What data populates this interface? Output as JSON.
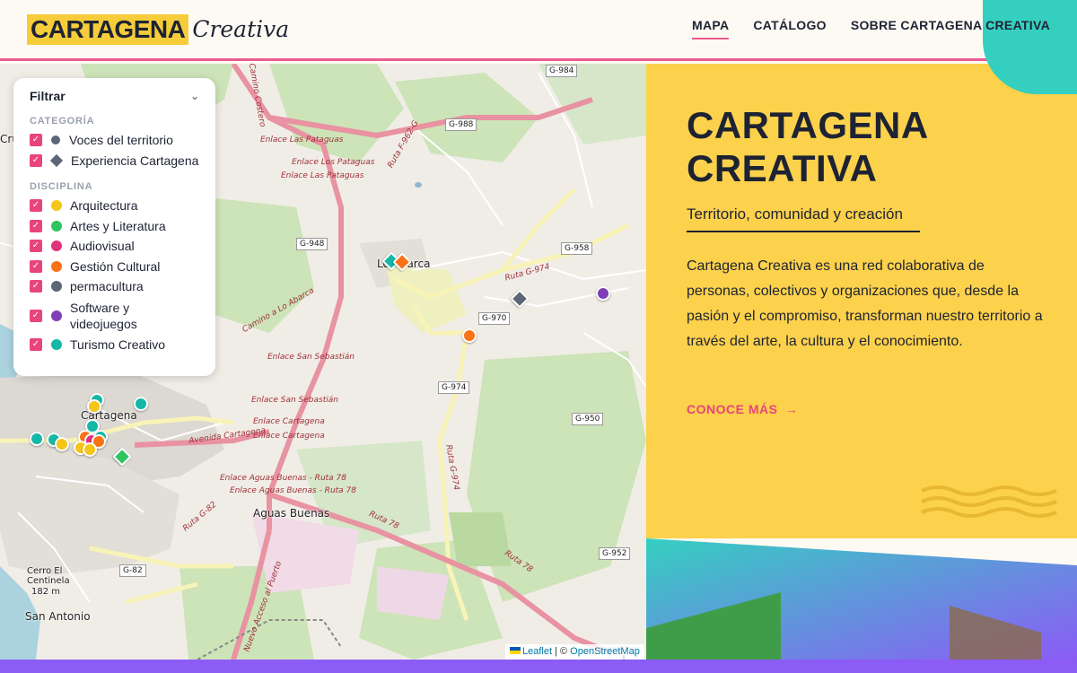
{
  "header": {
    "logo_main": "CARTAGENA",
    "logo_sub": "Creativa",
    "nav": [
      {
        "label": "MAPA",
        "active": true
      },
      {
        "label": "CATÁLOGO",
        "active": false
      },
      {
        "label": "SOBRE CARTAGENA CREATIVA",
        "active": false
      }
    ]
  },
  "filter": {
    "title": "Filtrar",
    "category_title": "CATEGORÍA",
    "categories": [
      {
        "label": "Voces del territorio",
        "icon": "circle",
        "color": "#5d6677",
        "checked": true
      },
      {
        "label": "Experiencia Cartagena",
        "icon": "diamond",
        "color": "#5d6677",
        "checked": true
      }
    ],
    "discipline_title": "DISCIPLINA",
    "disciplines": [
      {
        "label": "Arquitectura",
        "color": "#f5c518",
        "checked": true
      },
      {
        "label": "Artes y Literatura",
        "color": "#2ec45f",
        "checked": true
      },
      {
        "label": "Audiovisual",
        "color": "#e0327a",
        "checked": true
      },
      {
        "label": "Gestión Cultural",
        "color": "#f97316",
        "checked": true
      },
      {
        "label": "permacultura",
        "color": "#5d6677",
        "checked": true
      },
      {
        "label": "Software y videojuegos",
        "color": "#7e3fb5",
        "checked": true
      },
      {
        "label": "Turismo Creativo",
        "color": "#14b8a6",
        "checked": true
      }
    ]
  },
  "map": {
    "places": {
      "cartagena": "Cartagena",
      "aguas_buenas": "Aguas Buenas",
      "san_antonio": "San Antonio",
      "lo_abarca": "Lo Abarca",
      "cerro": "Cerro El Centinela",
      "cerro_alt": "182 m",
      "cru": "Cru"
    },
    "roads": {
      "g984": "G-984",
      "g988": "G-988",
      "g948": "G-948",
      "g958": "G-958",
      "g970": "G-970",
      "g974": "G-974",
      "g950": "G-950",
      "g952": "G-952",
      "g82": "G-82"
    },
    "streets": {
      "s1": "Enlace Las Pataguas",
      "s2": "Enlace Los Pataguas",
      "s3": "Enlace Las Pataguas",
      "s4": "Enlace San Sebastián",
      "s5": "Enlace San Sebastián",
      "s6": "Enlace Cartagena",
      "s7": "Enlace Cartagena",
      "s8": "Enlace Aguas Buenas - Ruta 78",
      "s9": "Enlace Aguas Buenas - Ruta 78",
      "s10": "Ruta 78",
      "s11": "Ruta 78",
      "s12": "Avenida Cartagena",
      "s13": "Camino a Lo Abarca",
      "s14": "Camino Costero",
      "s15": "Ruta G-974",
      "s16": "Ruta F-962-G",
      "s17": "Nuevo Acceso al Puerto",
      "s18": "Ruta G-974",
      "s19": "Ruta G-82"
    },
    "zoom_in": "+",
    "zoom_out": "−",
    "attrib_leaflet": "Leaflet",
    "attrib_sep": " | © ",
    "attrib_osm": "OpenStreetMap"
  },
  "hero": {
    "title_line1": "CARTAGENA",
    "title_line2": "CREATIVA",
    "subtitle": "Territorio, comunidad y creación",
    "description": "Cartagena Creativa es una red colaborativa de personas, colectivos y organizaciones que, desde la pasión y el compromiso, transforman nuestro territorio a través del arte, la cultura y el conocimiento.",
    "cta": "CONOCE MÁS",
    "cta_arrow": "→"
  },
  "colors": {
    "accent_pink": "#e8447d",
    "yellow": "#fcd14b",
    "dark": "#1e2333",
    "teal": "#35cfc0",
    "purple": "#8b5cf6"
  }
}
